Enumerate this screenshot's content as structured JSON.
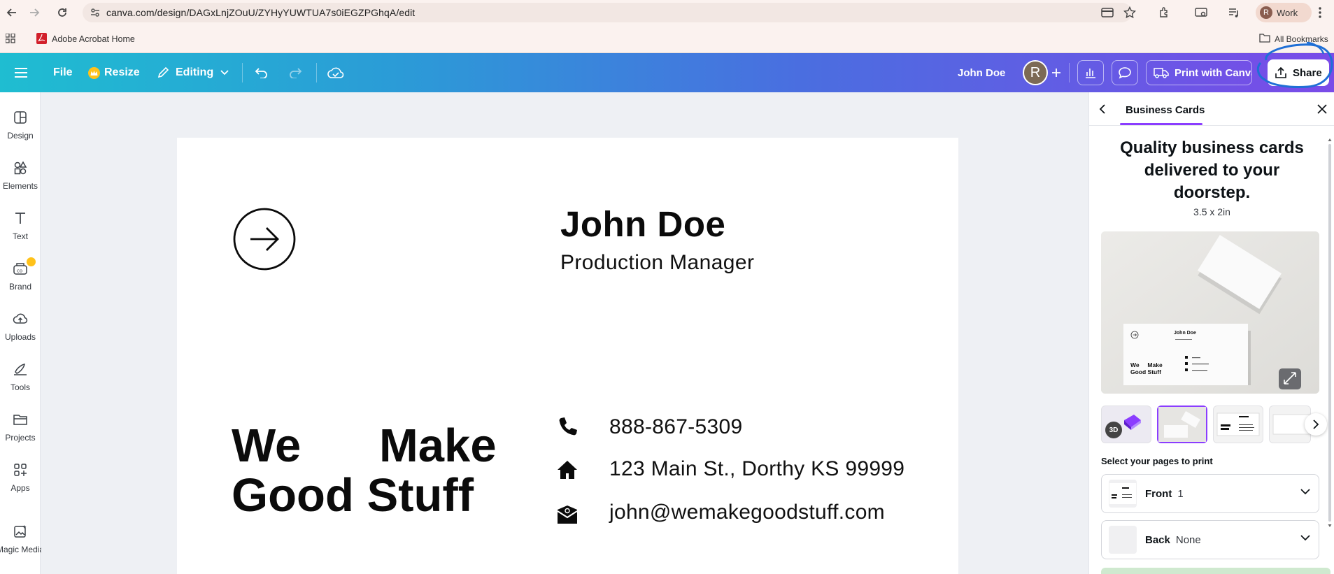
{
  "browser": {
    "url": "canva.com/design/DAGxLnjZOuU/ZYHyYUWTUA7s0iEGZPGhqA/edit",
    "profile_initial": "R",
    "profile_label": "Work",
    "bookmark_1": "Adobe Acrobat Home",
    "bookmark_all": "All Bookmarks"
  },
  "toolbar": {
    "file": "File",
    "resize": "Resize",
    "editing": "Editing",
    "user_name": "John Doe",
    "avatar_initial": "R",
    "print": "Print with Canva",
    "share": "Share"
  },
  "sidebar": {
    "items": [
      {
        "label": "Design",
        "icon": "design-icon"
      },
      {
        "label": "Elements",
        "icon": "elements-icon"
      },
      {
        "label": "Text",
        "icon": "text-icon"
      },
      {
        "label": "Brand",
        "icon": "brand-icon"
      },
      {
        "label": "Uploads",
        "icon": "uploads-icon"
      },
      {
        "label": "Tools",
        "icon": "tools-icon"
      },
      {
        "label": "Projects",
        "icon": "projects-icon"
      },
      {
        "label": "Apps",
        "icon": "apps-icon"
      },
      {
        "label": "Magic Media",
        "icon": "magic-media-icon"
      }
    ]
  },
  "card": {
    "name": "John Doe",
    "title": "Production Manager",
    "slogan_line1": "We      Make",
    "slogan_line2": "Good Stuff",
    "phone": "888-867-5309",
    "address": "123 Main St., Dorthy KS 99999",
    "email": "john@wemakegoodstuff.com"
  },
  "panel": {
    "tab": "Business Cards",
    "headline_1": "Quality business cards",
    "headline_2": "delivered to your",
    "headline_3": "doorstep.",
    "size": "3.5 x 2in",
    "thumb_3d_label": "3D",
    "select_label": "Select your pages to print",
    "pages": [
      {
        "name": "Front",
        "value": "1"
      },
      {
        "name": "Back",
        "value": "None"
      }
    ],
    "mock_card_name": "John Doe",
    "mock_card_slogan_1": "We     Make",
    "mock_card_slogan_2": "Good Stuff"
  },
  "colors": {
    "accent": "#8b3dff",
    "toolbar_start": "#1fbdd1",
    "toolbar_end": "#7a4be8",
    "annotation": "#1f6fd6"
  }
}
